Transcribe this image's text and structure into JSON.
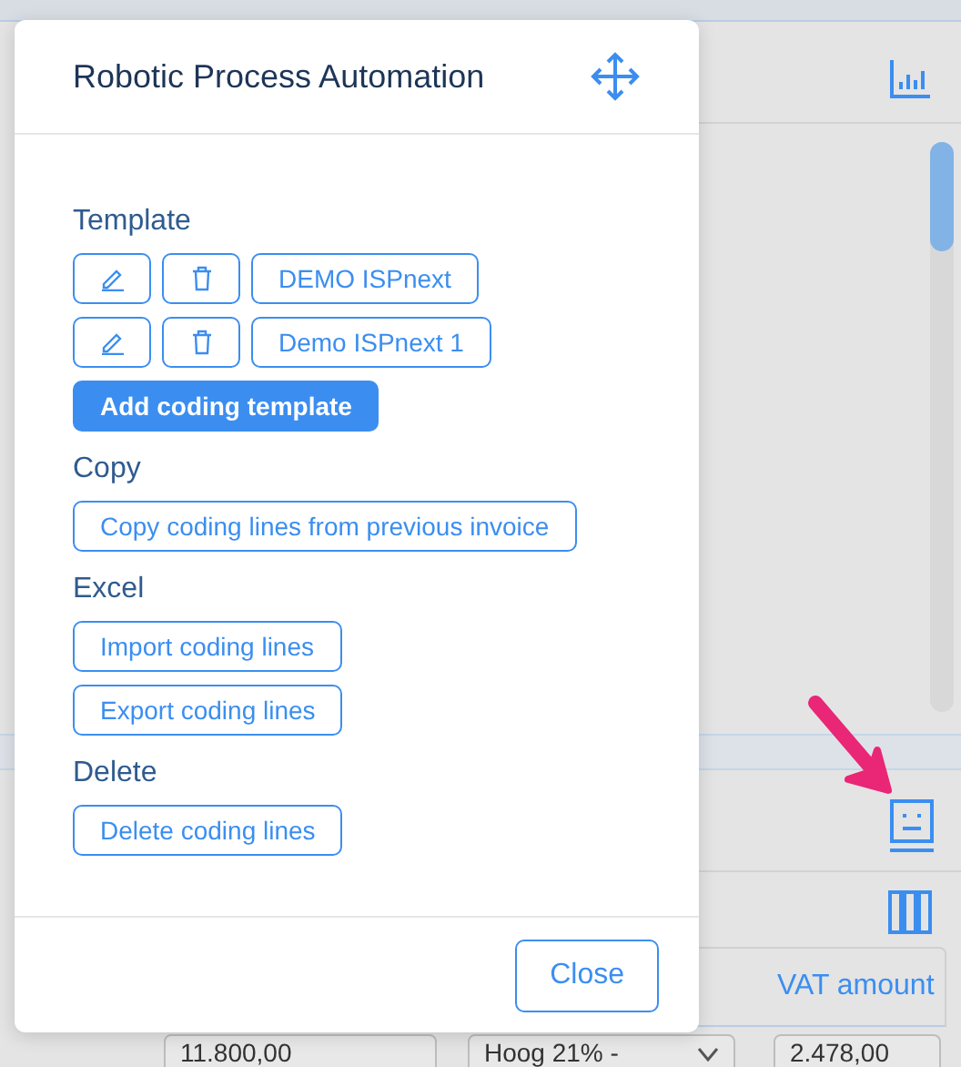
{
  "modal": {
    "title": "Robotic Process Automation",
    "sections": [
      {
        "heading": "Template",
        "rows": [
          {
            "kind": "template",
            "label": "DEMO ISPnext"
          },
          {
            "kind": "template",
            "label": "Demo ISPnext 1"
          },
          {
            "kind": "primary",
            "label": "Add coding template"
          }
        ]
      },
      {
        "heading": "Copy",
        "rows": [
          {
            "kind": "action",
            "label": "Copy coding lines from previous invoice"
          }
        ]
      },
      {
        "heading": "Excel",
        "rows": [
          {
            "kind": "action",
            "label": "Import coding lines"
          },
          {
            "kind": "action",
            "label": "Export coding lines"
          }
        ]
      },
      {
        "heading": "Delete",
        "rows": [
          {
            "kind": "action",
            "label": "Delete coding lines"
          }
        ]
      }
    ],
    "close_button": "Close"
  },
  "table": {
    "column_header": "VAT amount",
    "row": {
      "amount": "11.800,00",
      "vat_rate": "Hoog 21% -",
      "vat_amount": "2.478,00"
    }
  }
}
